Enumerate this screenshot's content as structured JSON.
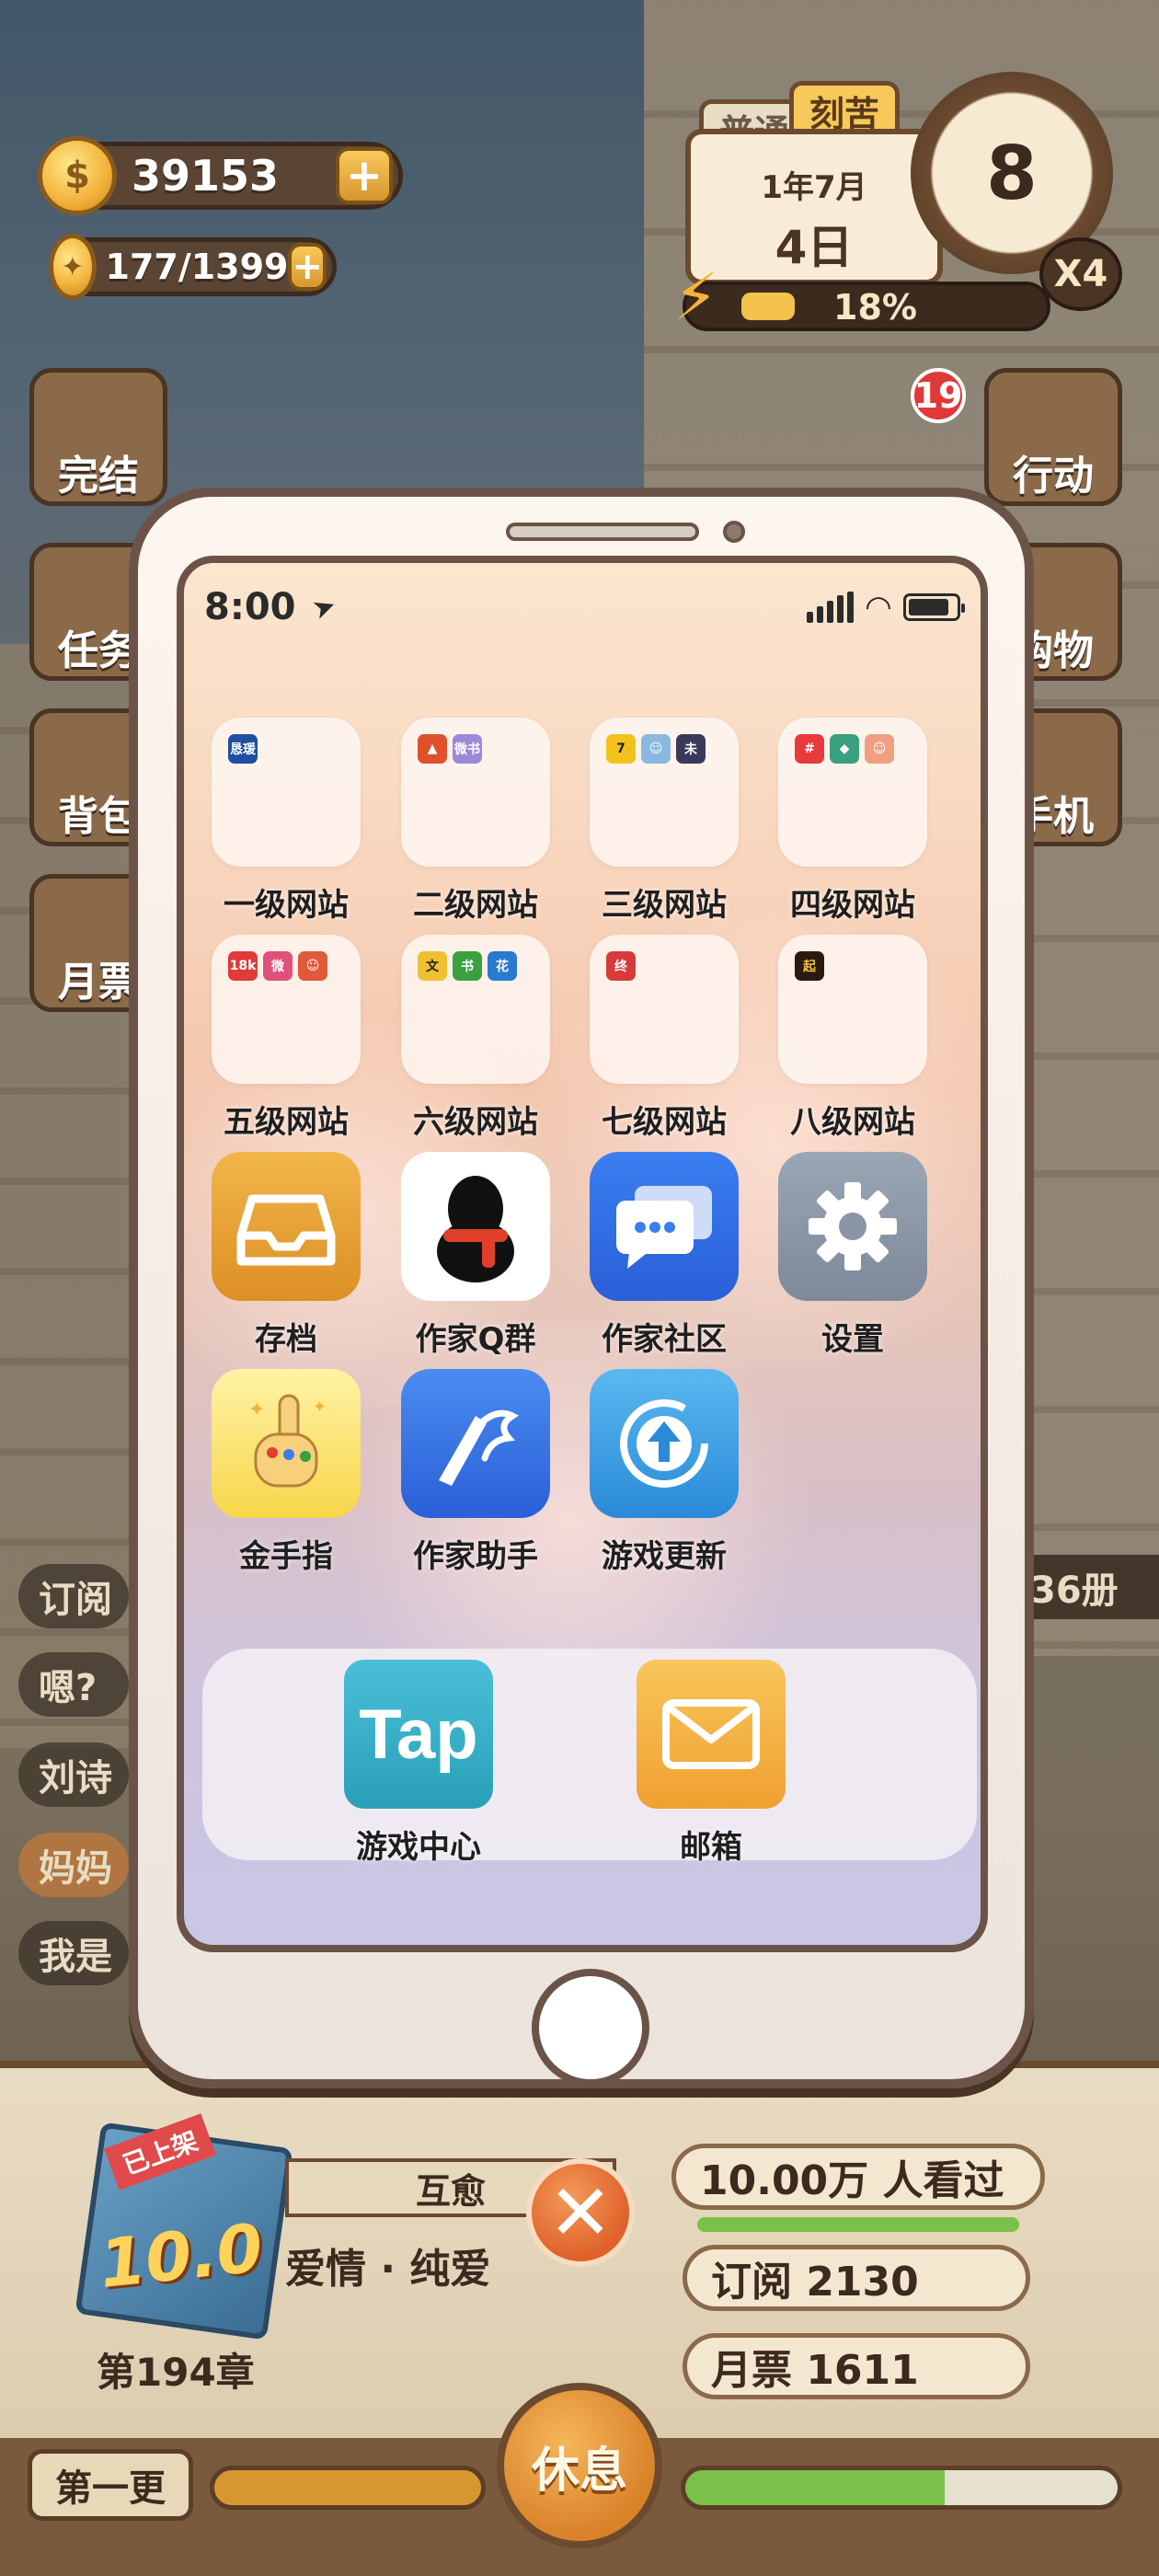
{
  "hud": {
    "coins": "39153",
    "ideas": "177/1399",
    "plus_label": "+",
    "mode_normal": "普通",
    "mode_hard": "刻苦",
    "month": "1年7月",
    "day": "4日",
    "energy_percent": "18%",
    "energy_fraction": 0.18,
    "clock_hour": "8",
    "speed": "X4",
    "alarm_badge": "19"
  },
  "side_menu": {
    "left": [
      "完结",
      "任务",
      "背包",
      "月票"
    ],
    "right": [
      "行动",
      "购物",
      "手机"
    ]
  },
  "book_count": "36册",
  "chat_lines": [
    "订阅",
    "嗯?",
    "刘诗",
    "妈妈",
    "我是"
  ],
  "phone": {
    "status": {
      "time": "8:00"
    },
    "apps": [
      {
        "label": "一级网站",
        "type": "folder",
        "minis": [
          {
            "text": "恳瑗",
            "color": "#1f4fa0"
          }
        ]
      },
      {
        "label": "二级网站",
        "type": "folder",
        "minis": [
          {
            "text": "▲",
            "color": "#e0512a"
          },
          {
            "text": "微书",
            "color": "#9a8ad8"
          }
        ]
      },
      {
        "label": "三级网站",
        "type": "folder",
        "minis": [
          {
            "text": "7",
            "color": "#f3c21a"
          },
          {
            "text": "☺",
            "color": "#8ab8e0"
          },
          {
            "text": "未",
            "color": "#3a3a5a"
          }
        ]
      },
      {
        "label": "四级网站",
        "type": "folder",
        "minis": [
          {
            "text": "#",
            "color": "#e83a3a"
          },
          {
            "text": "◆",
            "color": "#3aa080"
          },
          {
            "text": "☺",
            "color": "#f0a080"
          }
        ]
      },
      {
        "label": "五级网站",
        "type": "folder",
        "minis": [
          {
            "text": "18k",
            "color": "#e03a3a"
          },
          {
            "text": "微",
            "color": "#e0507a"
          },
          {
            "text": "☺",
            "color": "#e05a3a"
          }
        ]
      },
      {
        "label": "六级网站",
        "type": "folder",
        "minis": [
          {
            "text": "文",
            "color": "#f0c030"
          },
          {
            "text": "书",
            "color": "#3aa040"
          },
          {
            "text": "花",
            "color": "#2a7ad0"
          }
        ]
      },
      {
        "label": "七级网站",
        "type": "folder",
        "minis": [
          {
            "text": "终",
            "color": "#d83a3a"
          }
        ]
      },
      {
        "label": "八级网站",
        "type": "folder",
        "minis": [
          {
            "text": "起",
            "color": "#2a1a10"
          }
        ]
      },
      {
        "label": "存档",
        "type": "app"
      },
      {
        "label": "作家Q群",
        "type": "app"
      },
      {
        "label": "作家社区",
        "type": "app"
      },
      {
        "label": "设置",
        "type": "app"
      },
      {
        "label": "金手指",
        "type": "app"
      },
      {
        "label": "作家助手",
        "type": "app"
      },
      {
        "label": "游戏更新",
        "type": "app"
      }
    ],
    "dock": [
      {
        "label": "游戏中心",
        "icon_text": "Tap"
      },
      {
        "label": "邮箱"
      }
    ]
  },
  "novel": {
    "platform_tag": "已上架",
    "score": "10.0",
    "chapter": "第194章",
    "title": "互愈",
    "genre": "爱情 · 纯爱",
    "views": "10.00万 人看过",
    "subscriptions": "订阅 2130",
    "monthly_tickets": "月票 1611",
    "update_button": "第一更",
    "rest_button": "休息"
  },
  "colors": {
    "accent_orange": "#e0612a",
    "progress_green": "#7bc04a",
    "frame_brown": "#6b4a30"
  }
}
